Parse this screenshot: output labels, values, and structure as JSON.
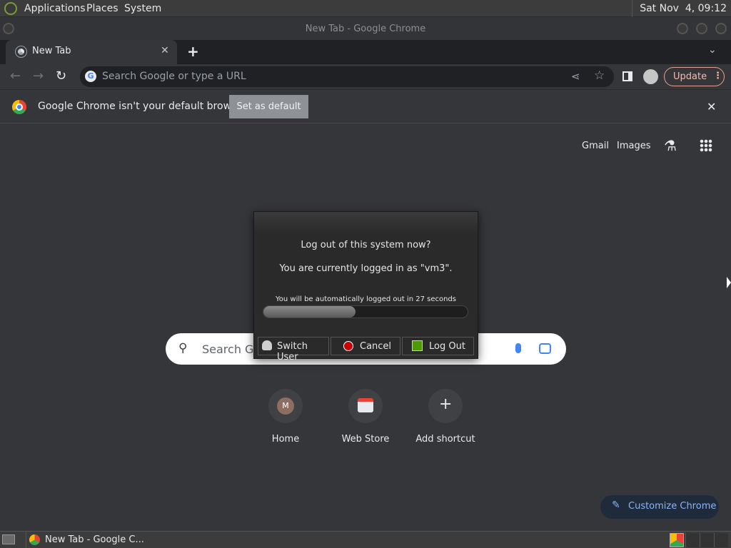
{
  "top_panel": {
    "menus": [
      "Applications",
      "Places",
      "System"
    ],
    "clock": "Sat Nov  4, 09:12"
  },
  "window": {
    "title": "New Tab - Google Chrome"
  },
  "tabs": [
    {
      "label": "New Tab"
    }
  ],
  "toolbar": {
    "omnibox_placeholder": "Search Google or type a URL",
    "update_label": "Update"
  },
  "infobar": {
    "message": "Google Chrome isn't your default browser",
    "button": "Set as default"
  },
  "ntp": {
    "links": [
      "Gmail",
      "Images"
    ],
    "search_placeholder": "Search Go",
    "shortcuts": [
      {
        "label": "Home",
        "initial": "M"
      },
      {
        "label": "Web Store"
      },
      {
        "label": "Add shortcut"
      }
    ],
    "customize_label": "Customize Chrome"
  },
  "dialog": {
    "question": "Log out of this system now?",
    "logged_in": "You are currently logged in as \"vm3\".",
    "countdown": "You will be automatically logged out in 27 seconds",
    "progress_fraction": 0.45,
    "buttons": [
      "Switch User",
      "Cancel",
      "Log Out"
    ]
  },
  "taskbar": {
    "window_item": "New Tab - Google C..."
  },
  "colors": {
    "accent_blue": "#8ab4f8",
    "update_red": "#f1bbb3",
    "cancel_red": "#cc0000"
  }
}
